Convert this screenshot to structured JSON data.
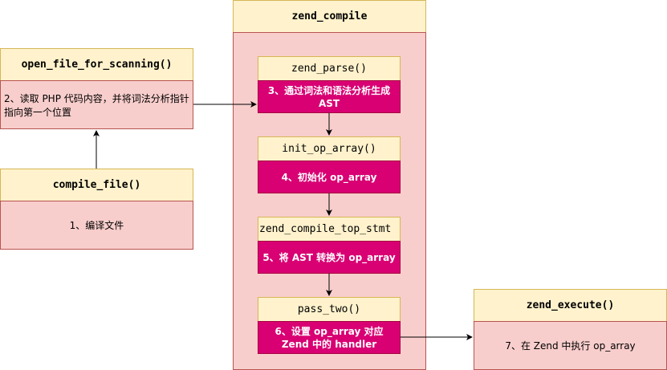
{
  "open_file": {
    "title": "open_file_for_scanning()",
    "desc": "2、读取 PHP 代码内容，并将词法分析指针指向第一个位置"
  },
  "compile_file": {
    "title": "compile_file()",
    "desc": "1、编译文件"
  },
  "zend_compile": {
    "title": "zend_compile",
    "steps": [
      {
        "title": "zend_parse()",
        "desc": "3、通过词法和语法分析生成 AST"
      },
      {
        "title": "init_op_array()",
        "desc": "4、初始化 op_array"
      },
      {
        "title": "zend_compile_top_stmt",
        "desc": "5、将 AST 转换为 op_array"
      },
      {
        "title": "pass_two()",
        "desc": "6、设置 op_array 对应 Zend 中的 handler"
      }
    ]
  },
  "zend_execute": {
    "title": "zend_execute()",
    "desc": "7、在 Zend 中执行 op_array"
  }
}
